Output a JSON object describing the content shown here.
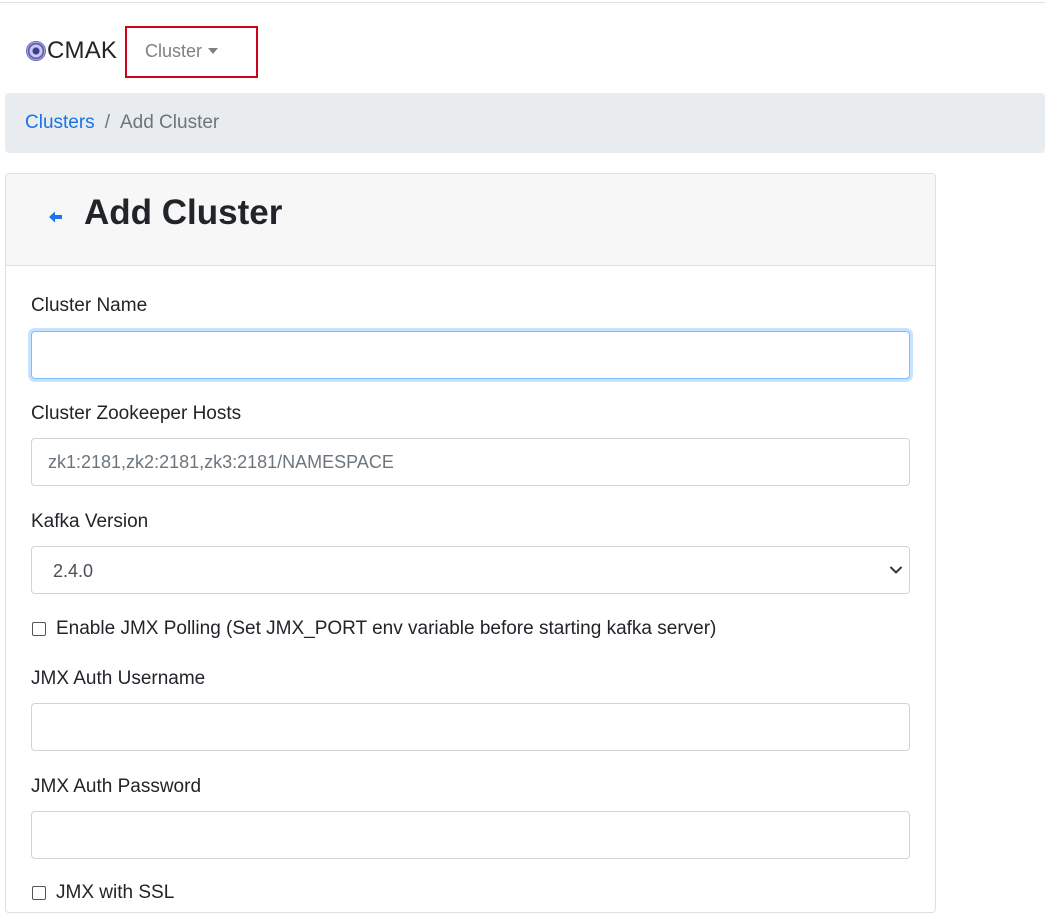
{
  "navbar": {
    "brand": "CMAK",
    "cluster_menu": "Cluster"
  },
  "breadcrumb": {
    "link": "Clusters",
    "separator": "/",
    "current": "Add Cluster"
  },
  "card": {
    "title": "Add Cluster"
  },
  "form": {
    "cluster_name": {
      "label": "Cluster Name",
      "value": "",
      "placeholder": ""
    },
    "zk_hosts": {
      "label": "Cluster Zookeeper Hosts",
      "value": "",
      "placeholder": "zk1:2181,zk2:2181,zk3:2181/NAMESPACE"
    },
    "kafka_version": {
      "label": "Kafka Version",
      "selected": "2.4.0"
    },
    "jmx_polling": {
      "label": "Enable JMX Polling (Set JMX_PORT env variable before starting kafka server)",
      "checked": false
    },
    "jmx_username": {
      "label": "JMX Auth Username",
      "value": ""
    },
    "jmx_password": {
      "label": "JMX Auth Password",
      "value": ""
    },
    "jmx_ssl": {
      "label": "JMX with SSL",
      "checked": false
    }
  },
  "colors": {
    "link": "#1a73e8",
    "highlight_box": "#d0021b",
    "breadcrumb_bg": "#e9ecef",
    "focus_ring": "#80bdff"
  }
}
